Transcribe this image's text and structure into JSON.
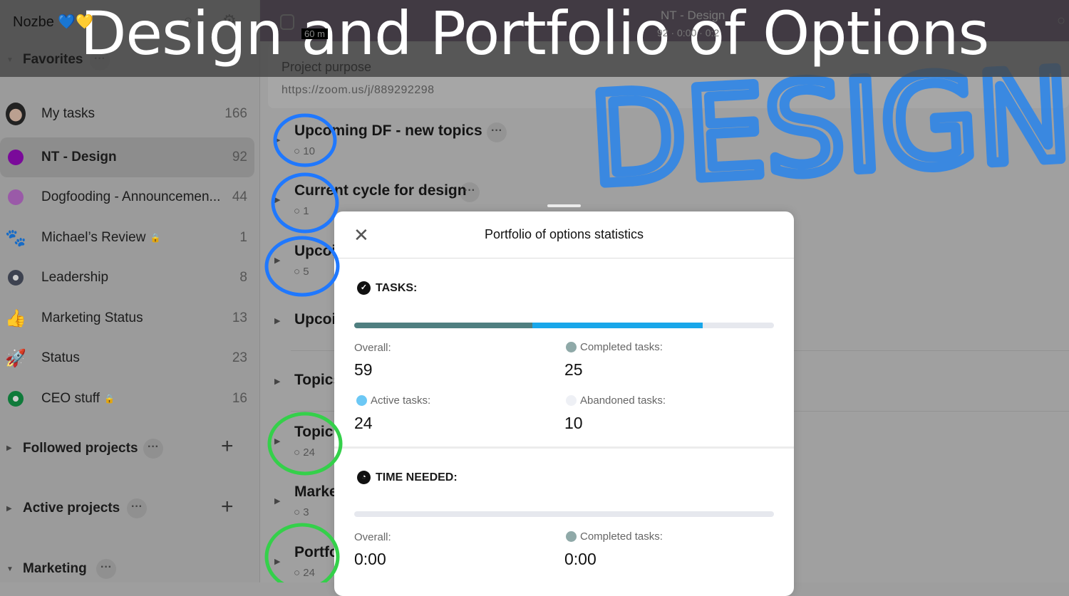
{
  "overlay_title": "Design and Portfolio of Options",
  "annotation": "DESIGN",
  "sidebar": {
    "brand": "Nozbe 💙💛",
    "favorites": "Favorites",
    "items": [
      {
        "label": "My tasks",
        "count": "166",
        "icon": "avatar"
      },
      {
        "label": "NT - Design",
        "count": "92",
        "icon": "dot",
        "color": "#7a0a9a",
        "selected": true
      },
      {
        "label": "Dogfooding - Announcemen...",
        "count": "44",
        "icon": "dot",
        "color": "#9a5aa8"
      },
      {
        "label": "Michael’s Review",
        "count": "1",
        "icon": "paw",
        "color": "#b0183a",
        "locked": true
      },
      {
        "label": "Leadership",
        "count": "8",
        "icon": "ring",
        "color": "#3d4250"
      },
      {
        "label": "Marketing Status",
        "count": "13",
        "icon": "thumbs-up",
        "color": "#1a7ac0"
      },
      {
        "label": "Status",
        "count": "23",
        "icon": "rocket",
        "color": "#6b7a20"
      },
      {
        "label": "CEO stuff",
        "count": "16",
        "icon": "ring",
        "color": "#0f7a3a",
        "locked": true
      }
    ],
    "sections": [
      "Followed projects",
      "Active projects",
      "Marketing"
    ]
  },
  "header": {
    "project": "NT - Design",
    "stats": "92 · 0:00 · 0:2",
    "badge": "60 m"
  },
  "main": {
    "purpose_label": "Project purpose",
    "purpose_url": "https://zoom.us/j/889292298",
    "rows": [
      {
        "title": "Upcoming DF - new topics",
        "sub": "10"
      },
      {
        "title": "Current cycle for design",
        "sub": "1"
      },
      {
        "title": "Upcoi",
        "sub": "5"
      },
      {
        "title": "Upcoi",
        "sub": ""
      },
      {
        "title": "Topics",
        "sub": ""
      },
      {
        "title": "Topic",
        "sub": "24"
      },
      {
        "title": "Marke",
        "sub": "3"
      },
      {
        "title": "Portfo",
        "sub": "24"
      }
    ]
  },
  "modal": {
    "title": "Portfolio of options statistics",
    "tasks": {
      "heading": "TASKS:",
      "overall_label": "Overall:",
      "overall": "59",
      "completed_label": "Completed tasks:",
      "completed": "25",
      "active_label": "Active tasks:",
      "active": "24",
      "abandoned_label": "Abandoned tasks:",
      "abandoned": "10",
      "colors": {
        "completed": "#4f7f80",
        "active": "#19a7ea",
        "abandoned": "#e6e8ee"
      }
    },
    "time": {
      "heading": "TIME NEEDED:",
      "overall_label": "Overall:",
      "overall": "0:00",
      "completed_label": "Completed tasks:",
      "completed": "0:00"
    }
  }
}
